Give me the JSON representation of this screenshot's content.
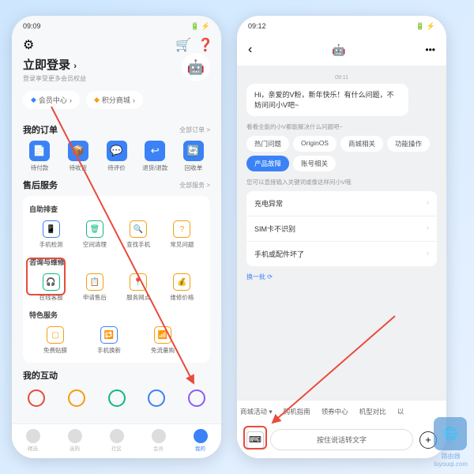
{
  "p1": {
    "time": "09:09",
    "signal": "📶 ⚡",
    "batt": "🔋 ⚡",
    "login_title": "立即登录",
    "login_sub": "登录享受更多会员权益",
    "avatar": "🤖",
    "member_center": "会员中心",
    "points_mall": "积分商城",
    "orders_title": "我的订单",
    "orders_more": "全部订单 >",
    "orders": [
      {
        "label": "待付款",
        "bg": "#3b82f6",
        "g": "📄"
      },
      {
        "label": "待收货",
        "bg": "#3b82f6",
        "g": "📦"
      },
      {
        "label": "待评价",
        "bg": "#3b82f6",
        "g": "💬"
      },
      {
        "label": "退货/退款",
        "bg": "#3b82f6",
        "g": "↩"
      },
      {
        "label": "回收单",
        "bg": "#3b82f6",
        "g": "🔄"
      }
    ],
    "aftersale_title": "售后服务",
    "aftersale_more": "全部服务 >",
    "selfcheck": "自助排查",
    "sc": [
      {
        "label": "手机检测",
        "c": "#3b82f6",
        "g": "📱"
      },
      {
        "label": "空间清理",
        "c": "#10b981",
        "g": "🗑"
      },
      {
        "label": "查找手机",
        "c": "#f59e0b",
        "g": "🔍"
      },
      {
        "label": "常见问题",
        "c": "#f59e0b",
        "g": "?"
      }
    ],
    "consult": "咨询与维修",
    "cr": [
      {
        "label": "在线客服",
        "c": "#10b981",
        "g": "🎧"
      },
      {
        "label": "申请售后",
        "c": "#f59e0b",
        "g": "📋"
      },
      {
        "label": "服务网点",
        "c": "#f59e0b",
        "g": "📍"
      },
      {
        "label": "维修价格",
        "c": "#f59e0b",
        "g": "💰"
      }
    ],
    "special": "特色服务",
    "sp": [
      {
        "label": "免费贴膜",
        "c": "#f59e0b",
        "g": "▢"
      },
      {
        "label": "手机换新",
        "c": "#3b82f6",
        "g": "🔁"
      },
      {
        "label": "免流量购",
        "c": "#f59e0b",
        "g": "📶"
      }
    ],
    "interact": "我的互动",
    "intc": [
      "#e74c3c",
      "#f59e0b",
      "#10b981",
      "#3b82f6",
      "#8b5cf6"
    ],
    "nav": [
      "精选",
      "选购",
      "社区",
      "会员",
      "我的"
    ]
  },
  "p2": {
    "time": "09:12",
    "signal": "📶 ⚡",
    "batt": "🔋 ⚡",
    "avatar": "🤖",
    "more": "•••",
    "ts": "09:11",
    "greeting": "Hi，亲爱的V粉，新年快乐！有什么问题，不妨问问小V吧~",
    "hint1": "看看全能的小V都能解决什么问题吧~",
    "chips": [
      "热门问题",
      "OriginOS",
      "商城相关",
      "功能操作",
      "产品故障",
      "账号相关"
    ],
    "active_chip": 4,
    "hint2": "您可以直接输入关键词或像这样问小V哦",
    "quick": [
      "充电异常",
      "SIM卡不识别",
      "手机或配件坏了"
    ],
    "refresh": "换一批 ⟳",
    "tags": [
      "商城活动",
      "购机指南",
      "领券中心",
      "机型对比",
      "以"
    ],
    "voice": "按住说话转文字",
    "kb": "⌨",
    "plus": "+"
  },
  "wm": {
    "t1": "路由器",
    "t2": "luyouqi.com"
  }
}
